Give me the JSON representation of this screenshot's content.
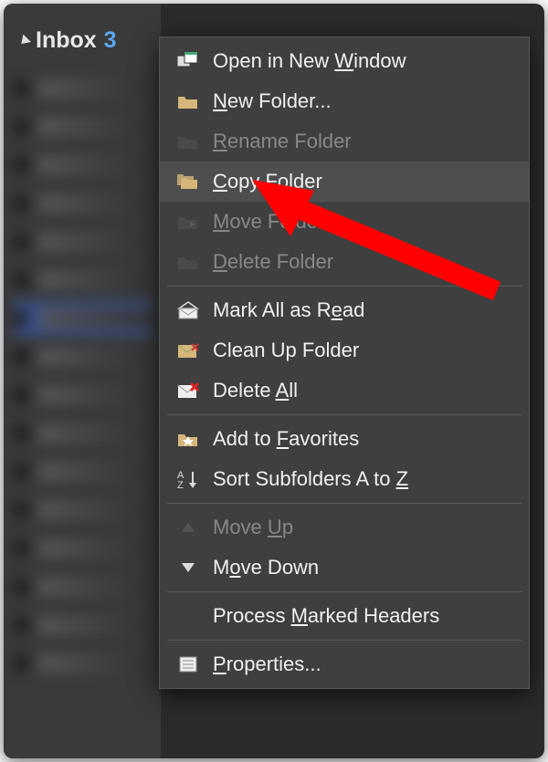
{
  "sidebar": {
    "inbox_label": "Inbox",
    "inbox_count": "3"
  },
  "menu": {
    "items": [
      {
        "label": "Open in New Window",
        "underline_char": "W",
        "icon": "windows-icon",
        "disabled": false,
        "hover": false
      },
      {
        "label": "New Folder...",
        "underline_char": "N",
        "icon": "folder-icon",
        "disabled": false,
        "hover": false
      },
      {
        "label": "Rename Folder",
        "underline_char": "R",
        "icon": "folder-dark-icon",
        "disabled": true,
        "hover": false
      },
      {
        "label": "Copy Folder",
        "underline_char": "C",
        "icon": "folders-icon",
        "disabled": false,
        "hover": true
      },
      {
        "label": "Move Folder",
        "underline_char": "M",
        "icon": "folder-move-icon",
        "disabled": true,
        "hover": false
      },
      {
        "label": "Delete Folder",
        "underline_char": "D",
        "icon": "folder-delete-icon",
        "disabled": true,
        "hover": false
      },
      {
        "sep": true
      },
      {
        "label": "Mark All as Read",
        "underline_char": "e",
        "icon": "envelope-open-icon",
        "disabled": false,
        "hover": false
      },
      {
        "label": "Clean Up Folder",
        "underline_char": "",
        "icon": "envelope-clean-icon",
        "disabled": false,
        "hover": false
      },
      {
        "label": "Delete All",
        "underline_char": "A",
        "icon": "envelope-delete-icon",
        "disabled": false,
        "hover": false
      },
      {
        "sep": true
      },
      {
        "label": "Add to Favorites",
        "underline_char": "F",
        "icon": "folder-star-icon",
        "disabled": false,
        "hover": false
      },
      {
        "label": "Sort Subfolders A to Z",
        "underline_char": "Z",
        "icon": "sort-az-icon",
        "disabled": false,
        "hover": false
      },
      {
        "sep": true
      },
      {
        "label": "Move Up",
        "underline_char": "U",
        "icon": "triangle-up-icon",
        "disabled": true,
        "hover": false
      },
      {
        "label": "Move Down",
        "underline_char": "o",
        "icon": "triangle-down-icon",
        "disabled": false,
        "hover": false
      },
      {
        "sep": true
      },
      {
        "label": "Process Marked Headers",
        "underline_char": "M",
        "icon": "",
        "disabled": false,
        "hover": false
      },
      {
        "sep": true
      },
      {
        "label": "Properties...",
        "underline_char": "P",
        "icon": "properties-icon",
        "disabled": false,
        "hover": false
      }
    ]
  },
  "colors": {
    "accent_blue": "#5aa8f2",
    "folder_tan": "#d6b67a",
    "arrow_red": "#ff0000"
  }
}
